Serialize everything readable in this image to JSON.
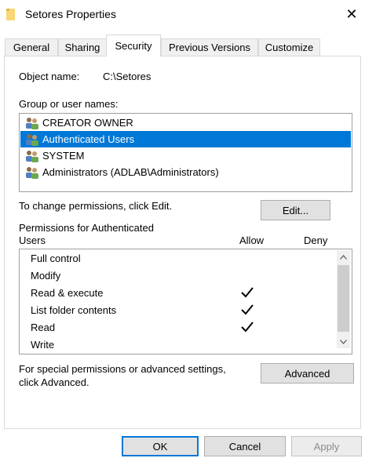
{
  "window": {
    "title": "Setores Properties",
    "close_glyph": "✕"
  },
  "tabs": [
    {
      "label": "General"
    },
    {
      "label": "Sharing"
    },
    {
      "label": "Security"
    },
    {
      "label": "Previous Versions"
    },
    {
      "label": "Customize"
    }
  ],
  "active_tab": "Security",
  "object": {
    "label": "Object name:",
    "value": "C:\\Setores"
  },
  "groups": {
    "label": "Group or user names:",
    "items": [
      {
        "name": "CREATOR OWNER",
        "selected": false
      },
      {
        "name": "Authenticated Users",
        "selected": true
      },
      {
        "name": "SYSTEM",
        "selected": false
      },
      {
        "name": "Administrators (ADLAB\\Administrators)",
        "selected": false
      }
    ]
  },
  "change_perm": {
    "text": "To change permissions, click Edit.",
    "edit_button": "Edit..."
  },
  "permissions": {
    "title_line1": "Permissions for Authenticated",
    "title_line2": "Users",
    "allow_header": "Allow",
    "deny_header": "Deny",
    "rows": [
      {
        "name": "Full control",
        "allow": false,
        "deny": false
      },
      {
        "name": "Modify",
        "allow": false,
        "deny": false
      },
      {
        "name": "Read & execute",
        "allow": true,
        "deny": false
      },
      {
        "name": "List folder contents",
        "allow": true,
        "deny": false
      },
      {
        "name": "Read",
        "allow": true,
        "deny": false
      },
      {
        "name": "Write",
        "allow": false,
        "deny": false
      }
    ]
  },
  "special": {
    "line1": "For special permissions or advanced settings,",
    "line2": "click Advanced.",
    "advanced_button": "Advanced"
  },
  "footer": {
    "ok": "OK",
    "cancel": "Cancel",
    "apply": "Apply"
  },
  "colors": {
    "selection": "#0078d7",
    "default_button_border": "#0078d7"
  }
}
